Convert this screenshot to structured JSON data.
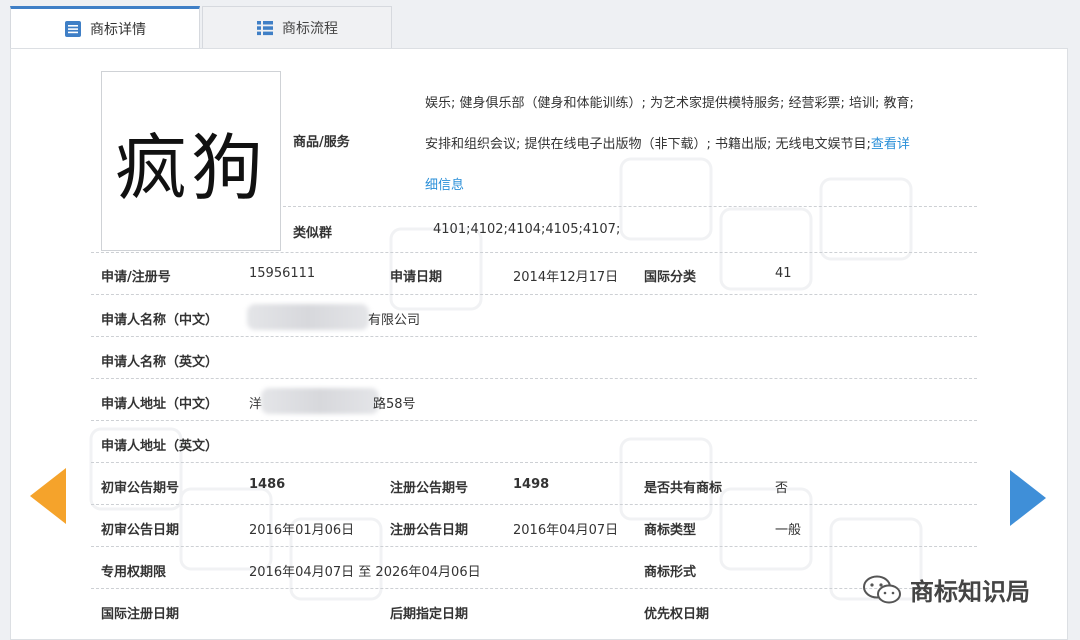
{
  "tabs": [
    {
      "label": "商标详情",
      "icon": "document-list-icon",
      "active": true
    },
    {
      "label": "商标流程",
      "icon": "grid-list-icon",
      "active": false
    }
  ],
  "trademark": {
    "mark_text": "疯狗",
    "goods_label": "商品/服务",
    "goods_lines": [
      "娱乐; 健身俱乐部（健身和体能训练）; 为艺术家提供模特服务; 经营彩票; 培训; 教育;",
      "安排和组织会议; 提供在线电子出版物（非下载）; 书籍出版; 无线电文娱节目;"
    ],
    "goods_more_link_a": "查看详",
    "goods_more_link_b": "细信息",
    "similar_group_label": "类似群",
    "similar_group_value": "4101;4102;4104;4105;4107;"
  },
  "fields": {
    "reg_no_label": "申请/注册号",
    "reg_no_value": "15956111",
    "apply_date_label": "申请日期",
    "apply_date_value": "2014年12月17日",
    "intl_class_label": "国际分类",
    "intl_class_value": "41",
    "applicant_cn_label": "申请人名称（中文）",
    "applicant_cn_value": "有限公司",
    "applicant_en_label": "申请人名称（英文）",
    "address_cn_label": "申请人地址（中文）",
    "address_cn_value_a": "洋",
    "address_cn_value_b": "路58号",
    "address_en_label": "申请人地址（英文）",
    "prelim_no_label": "初审公告期号",
    "prelim_no_value": "1486",
    "reg_pub_no_label": "注册公告期号",
    "reg_pub_no_value": "1498",
    "shared_label": "是否共有商标",
    "shared_value": "否",
    "prelim_date_label": "初审公告日期",
    "prelim_date_value": "2016年01月06日",
    "reg_pub_date_label": "注册公告日期",
    "reg_pub_date_value": "2016年04月07日",
    "type_label": "商标类型",
    "type_value": "一般",
    "exclusive_label": "专用权期限",
    "exclusive_value": "2016年04月07日 至 2026年04月06日",
    "form_label": "商标形式",
    "intl_reg_date_label": "国际注册日期",
    "later_designation_label": "后期指定日期",
    "priority_date_label": "优先权日期"
  },
  "wechat_badge": "商标知识局",
  "colors": {
    "accent_tab": "#3f7fc6",
    "link": "#2a8fd8",
    "prev_arrow": "#f5a32b",
    "next_arrow": "#3f8fd8"
  }
}
